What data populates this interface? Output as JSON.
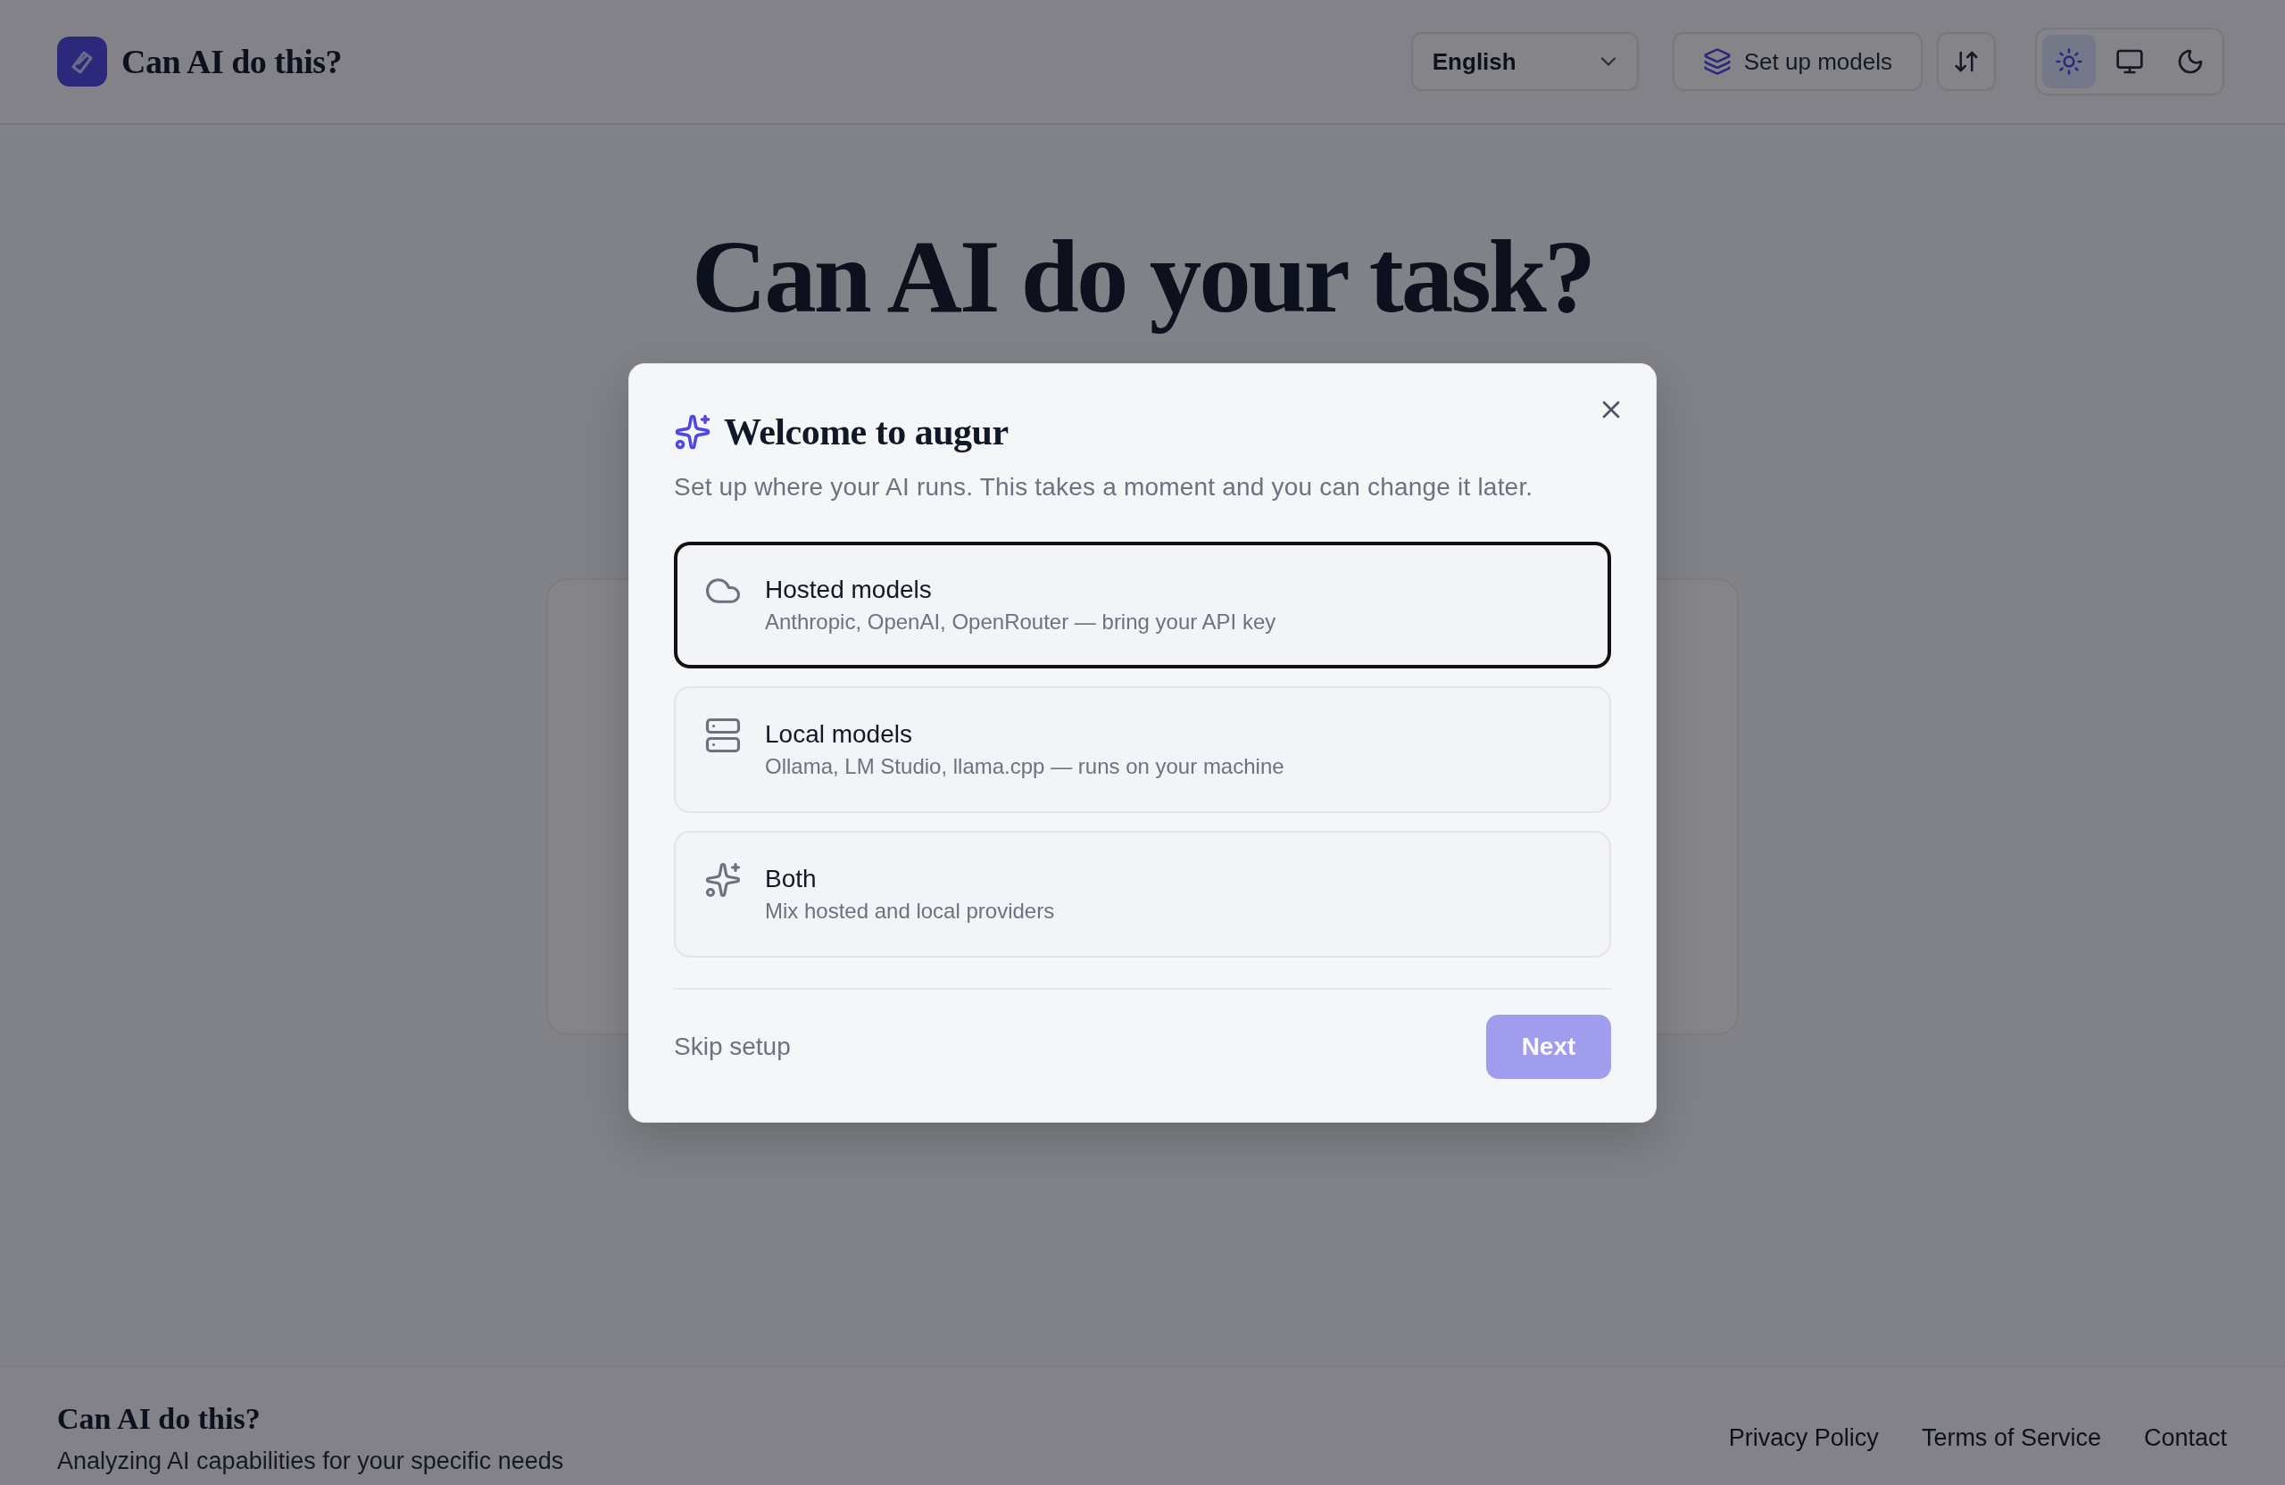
{
  "header": {
    "brand": "Can AI do this?",
    "language_select": {
      "value": "English"
    },
    "setup_button": {
      "label": "Set up models"
    },
    "theme_options": [
      {
        "kind": "light",
        "selected": true
      },
      {
        "kind": "system",
        "selected": false
      },
      {
        "kind": "dark",
        "selected": false
      }
    ]
  },
  "hero": {
    "title": "Can AI do your task?"
  },
  "dialog": {
    "title": "Welcome to augur",
    "subtitle": "Set up where your AI runs. This takes a moment and you can change it later.",
    "options": [
      {
        "kind": "hosted",
        "title": "Hosted models",
        "description": "Anthropic, OpenAI, OpenRouter — bring your API key",
        "selected": true
      },
      {
        "kind": "local",
        "title": "Local models",
        "description": "Ollama, LM Studio, llama.cpp — runs on your machine",
        "selected": false
      },
      {
        "kind": "both",
        "title": "Both",
        "description": "Mix hosted and local providers",
        "selected": false
      }
    ],
    "skip_link": "Skip setup",
    "next_button": {
      "label": "Next",
      "disabled": true
    }
  },
  "footer": {
    "brand": "Can AI do this?",
    "tagline": "Analyzing AI capabilities for your specific needs",
    "links": [
      "Privacy Policy",
      "Terms of Service",
      "Contact"
    ]
  }
}
